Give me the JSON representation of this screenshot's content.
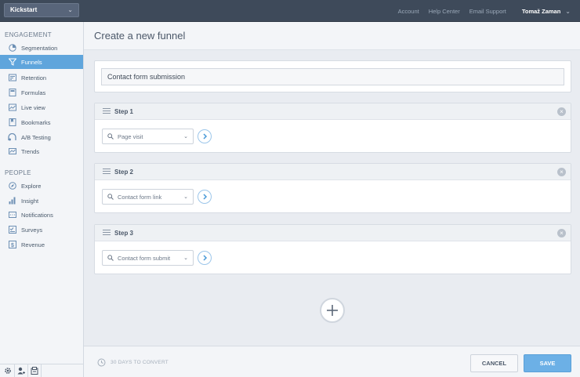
{
  "topbar": {
    "project": "Kickstart",
    "links": [
      "Account",
      "Help Center",
      "Email Support"
    ],
    "user": "Tomaž Zaman"
  },
  "sidebar": {
    "engagement_title": "ENGAGEMENT",
    "engagement_items": [
      {
        "label": "Segmentation",
        "icon": "pie-chart-icon"
      },
      {
        "label": "Funnels",
        "icon": "funnel-icon",
        "active": true
      },
      {
        "label": "Retention",
        "icon": "retention-icon"
      },
      {
        "label": "Formulas",
        "icon": "formula-icon"
      },
      {
        "label": "Live view",
        "icon": "live-view-icon"
      },
      {
        "label": "Bookmarks",
        "icon": "bookmark-icon"
      },
      {
        "label": "A/B Testing",
        "icon": "ab-test-icon"
      },
      {
        "label": "Trends",
        "icon": "trends-icon"
      }
    ],
    "people_title": "PEOPLE",
    "people_items": [
      {
        "label": "Explore",
        "icon": "explore-icon"
      },
      {
        "label": "Insight",
        "icon": "insight-icon"
      },
      {
        "label": "Notifications",
        "icon": "notifications-icon"
      },
      {
        "label": "Surveys",
        "icon": "surveys-icon"
      },
      {
        "label": "Revenue",
        "icon": "revenue-icon"
      }
    ],
    "footer_icons": [
      "gear-icon",
      "add-user-icon",
      "inbox-icon"
    ]
  },
  "main": {
    "title": "Create a new funnel",
    "funnel_name": "Contact form submission",
    "steps": [
      {
        "label": "Step 1",
        "event": "Page visit"
      },
      {
        "label": "Step 2",
        "event": "Contact form link"
      },
      {
        "label": "Step 3",
        "event": "Contact form submit"
      }
    ]
  },
  "footer": {
    "convert_label": "30 DAYS TO CONVERT",
    "cancel_label": "CANCEL",
    "save_label": "SAVE"
  },
  "colors": {
    "topbar": "#3e4a5a",
    "accent": "#5fa5dc",
    "save": "#6cb0e6"
  }
}
